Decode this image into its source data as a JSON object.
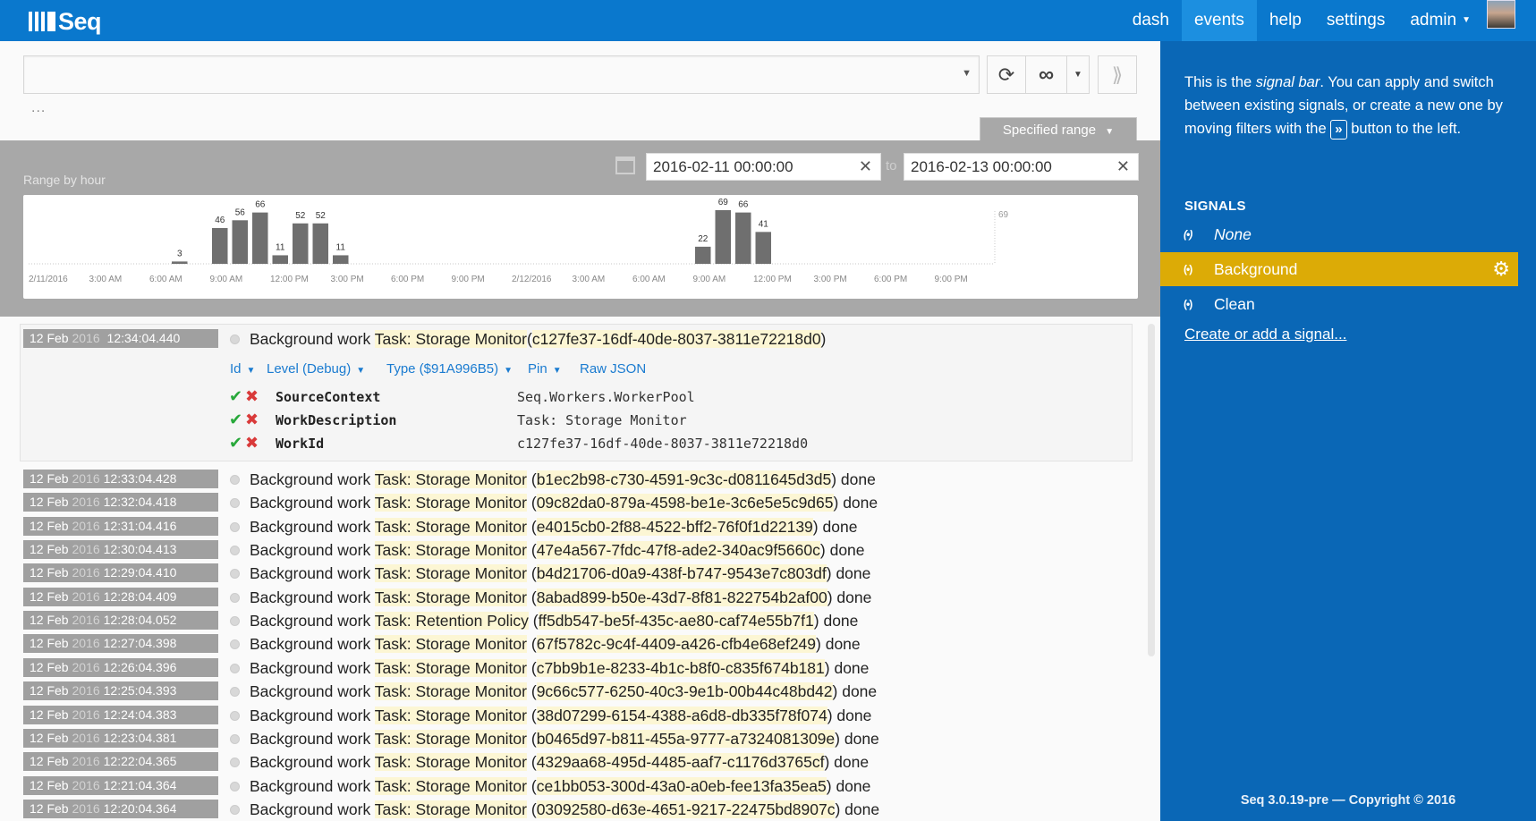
{
  "app": {
    "logo_text": "Seq",
    "nav": {
      "dash": "dash",
      "events": "events",
      "help": "help",
      "settings": "settings",
      "admin": "admin"
    }
  },
  "search": {
    "value": "",
    "placeholder": "",
    "ellipsis": "..."
  },
  "toolbar": {
    "refresh_icon": "refresh-icon",
    "tail_icon": "infinity-icon",
    "move_filter_icon": "double-chevron-icon"
  },
  "range": {
    "tab_label": "Specified range",
    "title": "Range by hour",
    "from": "2016-02-11 00:00:00",
    "to": "2016-02-13 00:00:00",
    "to_label": "to"
  },
  "chart_data": {
    "type": "bar",
    "title": "Range by hour",
    "hour_ticks": [
      "2/11/2016",
      "3:00 AM",
      "6:00 AM",
      "9:00 AM",
      "12:00 PM",
      "3:00 PM",
      "6:00 PM",
      "9:00 PM",
      "2/12/2016",
      "3:00 AM",
      "6:00 AM",
      "9:00 AM",
      "12:00 PM",
      "3:00 PM",
      "6:00 PM",
      "9:00 PM"
    ],
    "max_label": "69",
    "ylim": [
      0,
      69
    ],
    "bars": [
      {
        "hour": 7,
        "value": 3
      },
      {
        "hour": 9,
        "value": 46
      },
      {
        "hour": 10,
        "value": 56
      },
      {
        "hour": 11,
        "value": 66
      },
      {
        "hour": 12,
        "value": 11
      },
      {
        "hour": 13,
        "value": 52
      },
      {
        "hour": 14,
        "value": 52
      },
      {
        "hour": 15,
        "value": 11
      },
      {
        "hour": 33,
        "value": 22
      },
      {
        "hour": 34,
        "value": 69
      },
      {
        "hour": 35,
        "value": 66
      },
      {
        "hour": 36,
        "value": 41
      }
    ],
    "bar_color": "#6f6f6f"
  },
  "expanded_event": {
    "day": "12 Feb",
    "year": "2016",
    "time": "12:34:04.440",
    "msg_prefix": "Background work",
    "task": "Task: Storage Monitor",
    "id": "c127fe37-16df-40de-8037-3811e72218d0",
    "msg_suffix": "done",
    "tabs": [
      "Id",
      "Level (Debug)",
      "Type ($91A996B5)",
      "Pin",
      "Raw JSON"
    ],
    "properties": [
      {
        "name": "SourceContext",
        "value": "Seq.Workers.WorkerPool"
      },
      {
        "name": "WorkDescription",
        "value": "Task: Storage Monitor"
      },
      {
        "name": "WorkId",
        "value": "c127fe37-16df-40de-8037-3811e72218d0"
      }
    ]
  },
  "events": [
    {
      "day": "12 Feb",
      "year": "2016",
      "time": "12:33:04.428",
      "prefix": "Background work",
      "task": "Task: Storage Monitor",
      "id": "b1ec2b98-c730-4591-9c3c-d0811645d3d5",
      "suffix": "done"
    },
    {
      "day": "12 Feb",
      "year": "2016",
      "time": "12:32:04.418",
      "prefix": "Background work",
      "task": "Task: Storage Monitor",
      "id": "09c82da0-879a-4598-be1e-3c6e5e5c9d65",
      "suffix": "done"
    },
    {
      "day": "12 Feb",
      "year": "2016",
      "time": "12:31:04.416",
      "prefix": "Background work",
      "task": "Task: Storage Monitor",
      "id": "e4015cb0-2f88-4522-bff2-76f0f1d22139",
      "suffix": "done"
    },
    {
      "day": "12 Feb",
      "year": "2016",
      "time": "12:30:04.413",
      "prefix": "Background work",
      "task": "Task: Storage Monitor",
      "id": "47e4a567-7fdc-47f8-ade2-340ac9f5660c",
      "suffix": "done"
    },
    {
      "day": "12 Feb",
      "year": "2016",
      "time": "12:29:04.410",
      "prefix": "Background work",
      "task": "Task: Storage Monitor",
      "id": "b4d21706-d0a9-438f-b747-9543e7c803df",
      "suffix": "done"
    },
    {
      "day": "12 Feb",
      "year": "2016",
      "time": "12:28:04.409",
      "prefix": "Background work",
      "task": "Task: Storage Monitor",
      "id": "8abad899-b50e-43d7-8f81-822754b2af00",
      "suffix": "done"
    },
    {
      "day": "12 Feb",
      "year": "2016",
      "time": "12:28:04.052",
      "prefix": "Background work",
      "task": "Task: Retention Policy",
      "id": "ff5db547-be5f-435c-ae80-caf74e55b7f1",
      "suffix": "done"
    },
    {
      "day": "12 Feb",
      "year": "2016",
      "time": "12:27:04.398",
      "prefix": "Background work",
      "task": "Task: Storage Monitor",
      "id": "67f5782c-9c4f-4409-a426-cfb4e68ef249",
      "suffix": "done"
    },
    {
      "day": "12 Feb",
      "year": "2016",
      "time": "12:26:04.396",
      "prefix": "Background work",
      "task": "Task: Storage Monitor",
      "id": "c7bb9b1e-8233-4b1c-b8f0-c835f674b181",
      "suffix": "done"
    },
    {
      "day": "12 Feb",
      "year": "2016",
      "time": "12:25:04.393",
      "prefix": "Background work",
      "task": "Task: Storage Monitor",
      "id": "9c66c577-6250-40c3-9e1b-00b44c48bd42",
      "suffix": "done"
    },
    {
      "day": "12 Feb",
      "year": "2016",
      "time": "12:24:04.383",
      "prefix": "Background work",
      "task": "Task: Storage Monitor",
      "id": "38d07299-6154-4388-a6d8-db335f78f074",
      "suffix": "done"
    },
    {
      "day": "12 Feb",
      "year": "2016",
      "time": "12:23:04.381",
      "prefix": "Background work",
      "task": "Task: Storage Monitor",
      "id": "b0465d97-b811-455a-9777-a7324081309e",
      "suffix": "done"
    },
    {
      "day": "12 Feb",
      "year": "2016",
      "time": "12:22:04.365",
      "prefix": "Background work",
      "task": "Task: Storage Monitor",
      "id": "4329aa68-495d-4485-aaf7-c1176d3765cf",
      "suffix": "done"
    },
    {
      "day": "12 Feb",
      "year": "2016",
      "time": "12:21:04.364",
      "prefix": "Background work",
      "task": "Task: Storage Monitor",
      "id": "ce1bb053-300d-43a0-a0eb-fee13fa35ea5",
      "suffix": "done"
    },
    {
      "day": "12 Feb",
      "year": "2016",
      "time": "12:20:04.364",
      "prefix": "Background work",
      "task": "Task: Storage Monitor",
      "id": "03092580-d63e-4651-9217-22475bd8907c",
      "suffix": "done"
    }
  ],
  "signal_bar": {
    "help_1": "This is the",
    "help_em": "signal bar",
    "help_2": ". You can apply and switch between existing signals, or create a new one by moving filters with the",
    "help_kbd": "»",
    "help_3": "button to the left.",
    "heading": "SIGNALS",
    "signals": [
      "None",
      "Background",
      "Clean"
    ],
    "active_signal": "Background",
    "create_link": "Create or add a signal...",
    "copyright": "Seq 3.0.19-pre — Copyright © 2016"
  },
  "colors": {
    "topbar": "#0a78cd",
    "signal_bar": "#0a67b6",
    "active_signal": "#dcab06",
    "link": "#1a7bd0",
    "highlight": "#fcf6d4"
  }
}
